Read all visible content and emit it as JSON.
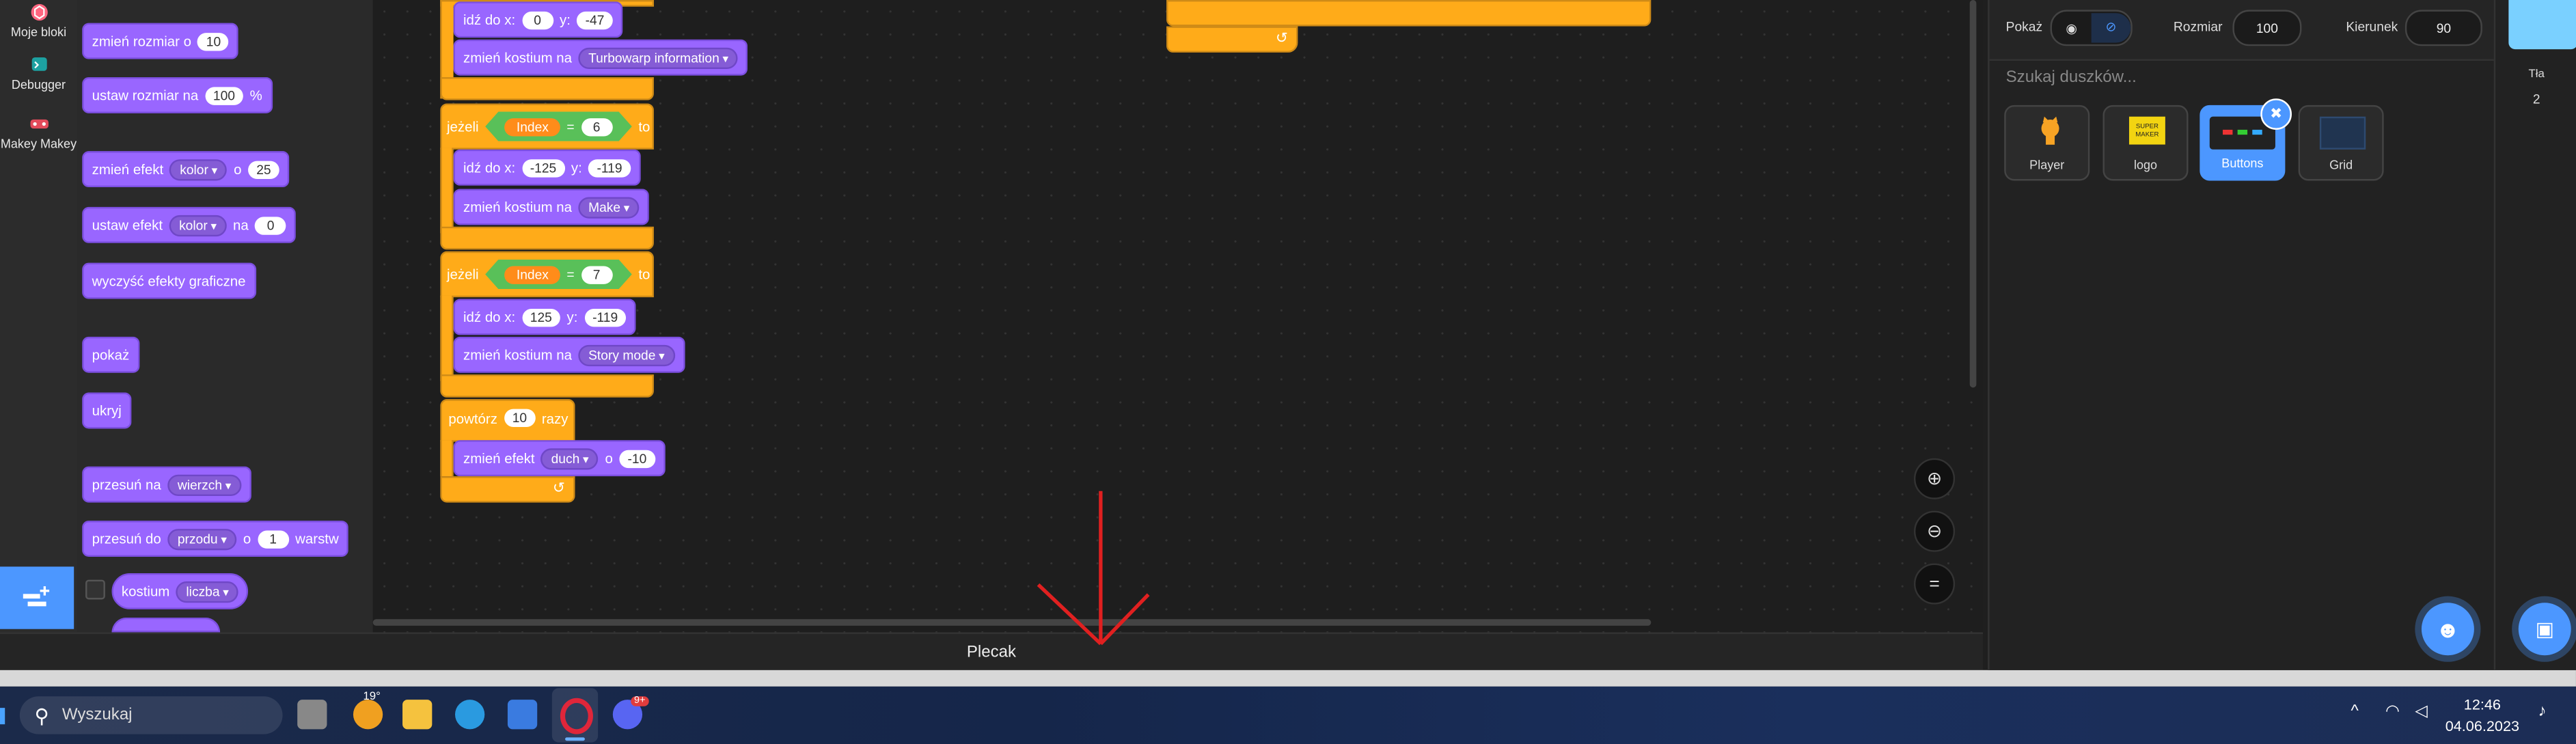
{
  "categories": [
    {
      "label": "Moje bloki",
      "icon": "my-blocks-icon"
    },
    {
      "label": "Debugger",
      "icon": "debugger-icon"
    },
    {
      "label": "Makey Makey",
      "icon": "makey-makey-icon"
    }
  ],
  "palette": {
    "change_size": {
      "text": "zmień rozmiar o",
      "value": "10"
    },
    "set_size": {
      "text": "ustaw rozmiar na",
      "value": "100",
      "suffix": "%"
    },
    "change_effect": {
      "text": "zmień efekt",
      "drop": "kolor",
      "o": "o",
      "value": "25"
    },
    "set_effect": {
      "text": "ustaw efekt",
      "drop": "kolor",
      "na": "na",
      "value": "0"
    },
    "clear_effects": "wyczyść efekty graficzne",
    "show": "pokaż",
    "hide": "ukryj",
    "go_to_layer": {
      "text": "przesuń na",
      "drop": "wierzch"
    },
    "go_layers": {
      "text": "przesuń do",
      "drop": "przodu",
      "o": "o",
      "value": "1",
      "suffix": "warstw"
    },
    "costume_reporter": {
      "text": "kostium",
      "drop": "liczba"
    }
  },
  "script": {
    "goto1": {
      "text": "idź do x:",
      "x": "0",
      "ylabel": "y:",
      "y": "-47"
    },
    "costume1": {
      "text": "zmień kostium na",
      "drop": "Turbowarp information"
    },
    "if6": {
      "if": "jeżeli",
      "var": "Index",
      "eq": "=",
      "val": "6",
      "then": "to"
    },
    "goto2": {
      "text": "idź do x:",
      "x": "-125",
      "ylabel": "y:",
      "y": "-119"
    },
    "costume2": {
      "text": "zmień kostium na",
      "drop": "Make"
    },
    "if7": {
      "if": "jeżeli",
      "var": "Index",
      "eq": "=",
      "val": "7",
      "then": "to"
    },
    "goto3": {
      "text": "idź do x:",
      "x": "125",
      "ylabel": "y:",
      "y": "-119"
    },
    "costume3": {
      "text": "zmień kostium na",
      "drop": "Story mode"
    },
    "repeat": {
      "text": "powtórz",
      "value": "10",
      "suffix": "razy"
    },
    "ghost": {
      "text": "zmień efekt",
      "drop": "duch",
      "o": "o",
      "value": "-10"
    }
  },
  "backpack": "Plecak",
  "sprite_info": {
    "show_label": "Pokaż",
    "size_label": "Rozmiar",
    "size": "100",
    "direction_label": "Kierunek",
    "direction": "90",
    "search_placeholder": "Szukaj duszków..."
  },
  "sprites": [
    {
      "name": "Player",
      "selected": false
    },
    {
      "name": "logo",
      "selected": false,
      "thumb_text": "SUPER MAKER"
    },
    {
      "name": "Buttons",
      "selected": true
    },
    {
      "name": "Grid",
      "selected": false
    }
  ],
  "stage_panel": {
    "label": "Tła",
    "count": "2"
  },
  "taskbar": {
    "search_placeholder": "Wyszukaj",
    "weather": "19°",
    "discord_badge": "9+",
    "time": "12:46",
    "date": "04.06.2023"
  },
  "colors": {
    "looks": "#9966ff",
    "control": "#ffab19",
    "operator": "#59c059",
    "variable": "#ff8c1a",
    "accent": "#4c97ff",
    "annotation_arrow": "#e02020"
  }
}
